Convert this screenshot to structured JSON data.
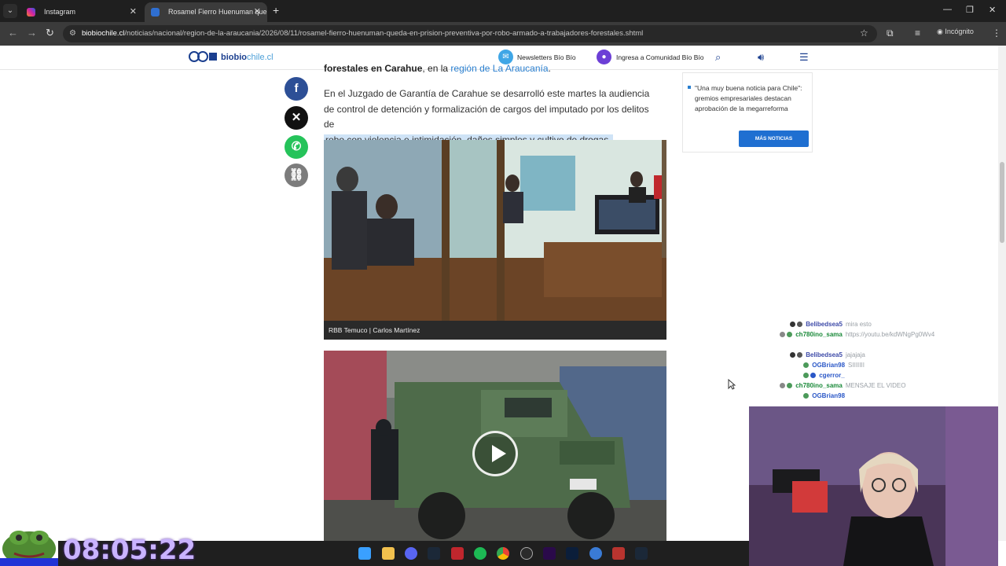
{
  "browser": {
    "tabs": [
      {
        "title": "Instagram",
        "active": false,
        "favicon_color": "#d6249f"
      },
      {
        "title": "Rosamel Fierro Huenuman que",
        "active": true,
        "favicon_color": "#2f6fd1"
      }
    ],
    "new_tab_glyph": "+",
    "url_domain": "biobiochile.cl",
    "url_path": "/noticias/nacional/region-de-la-araucania/2026/08/11/rosamel-fierro-huenuman-queda-en-prision-preventiva-por-robo-armado-a-trabajadores-forestales.shtml",
    "incognito_label": "Incógnito"
  },
  "site": {
    "logo_text_main": "biobio",
    "logo_text_suffix": "chile.cl",
    "logo_mark_text": "60",
    "newsletters_label": "Newsletters Bío Bío",
    "login_label": "Ingresa a Comunidad Bío Bío"
  },
  "article": {
    "top_bold": "forestales en Carahue",
    "top_mid": ", en la ",
    "top_link": "región de La Araucanía",
    "top_end": ".",
    "para_part1": "En el Juzgado de Garantía de Carahue se desarrolló este martes la audiencia de control de detención y formalización de cargos del imputado por los delitos de",
    "para_highlight": "robo con violencia e intimidación, daños simples y cultivo de drogas.",
    "photo_caption": "RBB Temuco | Carlos Martínez"
  },
  "sidebar": {
    "news_text": "\"Una muy buena noticia para Chile\": gremios empresariales destacan aprobación de la megarreforma",
    "more_button": "MÁS NOTICIAS"
  },
  "chat": [
    {
      "user": "Belibedsea5",
      "msg": "mira esto",
      "color": "#3d4aa8"
    },
    {
      "user": "ch780ino_sama",
      "msg": "https://youtu.be/kdWNgPg0Wv4",
      "color": "#1b8a3a"
    },
    {
      "user": "Belibedsea5",
      "msg": "jajajaja",
      "color": "#3d4aa8"
    },
    {
      "user": "OGBrian98",
      "msg": "SIIIIIII",
      "color": "#2a57c7"
    },
    {
      "user": "cgerror_",
      "msg": "",
      "color": "#2a57c7"
    },
    {
      "user": "ch780ino_sama",
      "msg": "MENSAJE EL VIDEO",
      "color": "#1b8a3a"
    },
    {
      "user": "OGBrian98",
      "msg": "",
      "color": "#2a57c7"
    }
  ],
  "stream": {
    "timer": "08:05:22"
  },
  "colors": {
    "accent": "#1f6fd1",
    "link": "#2a7fcf",
    "highlight": "#cfe3f6",
    "facebook": "#2d4f96",
    "x": "#111111",
    "whatsapp": "#25c35a",
    "link_share": "#7c7c7c"
  }
}
